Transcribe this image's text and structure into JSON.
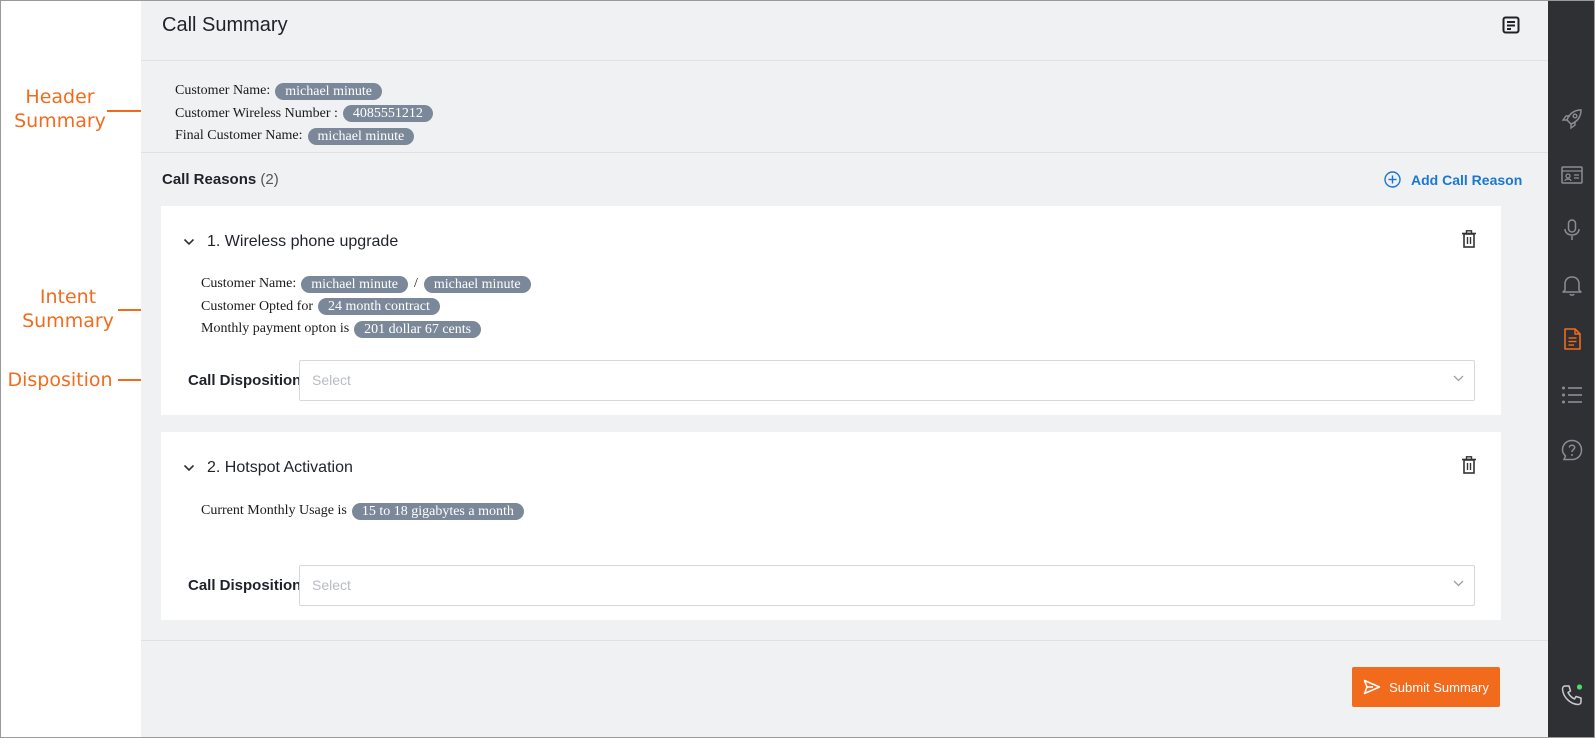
{
  "annotations": {
    "header_summary": [
      "Header",
      "Summary"
    ],
    "intent_summary": [
      "Intent",
      "Summary"
    ],
    "disposition": "Disposition"
  },
  "header": {
    "title": "Call Summary",
    "icon": "note-icon"
  },
  "summary": {
    "customer_name_label": "Customer Name:",
    "customer_name": "michael minute",
    "wireless_number_label": "Customer Wireless Number :",
    "wireless_number": "4085551212",
    "final_name_label": "Final Customer Name:",
    "final_name": "michael minute"
  },
  "call_reasons": {
    "title": "Call Reasons",
    "count": "(2)",
    "add_label": "Add Call Reason",
    "items": [
      {
        "title": "1. Wireless phone upgrade",
        "name_label": "Customer Name:",
        "name_a": "michael minute",
        "name_sep": "/",
        "name_b": "michael minute",
        "opted_label": "Customer Opted for",
        "opted_value": "24 month contract",
        "payment_label": "Monthly payment opton is",
        "payment_value": "201 dollar 67 cents",
        "disposition_label": "Call Disposition:",
        "disposition_placeholder": "Select"
      },
      {
        "title": "2. Hotspot Activation",
        "usage_label": "Current Monthly Usage is",
        "usage_value": "15 to 18 gigabytes a month",
        "disposition_label": "Call Disposition:",
        "disposition_placeholder": "Select"
      }
    ]
  },
  "submit_label": "Submit Summary",
  "colors": {
    "accent": "#f26b1d",
    "link": "#1a77d2",
    "chip": "#7b8899",
    "rail": "#2e3033"
  },
  "rail_icons": [
    "rocket-icon",
    "id-card-icon",
    "microphone-icon",
    "bell-icon",
    "document-icon",
    "list-icon",
    "help-icon",
    "phone-icon"
  ]
}
